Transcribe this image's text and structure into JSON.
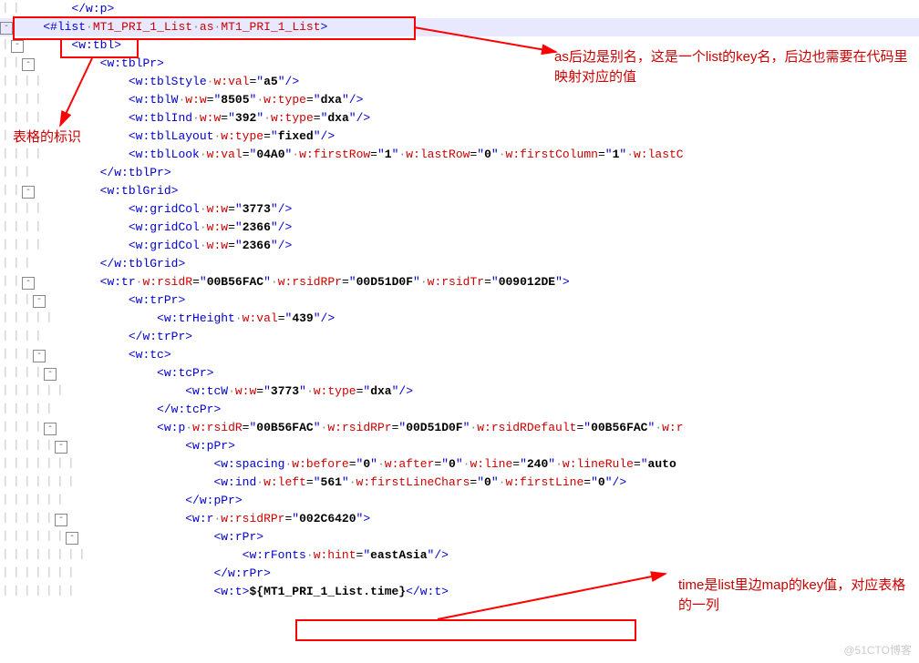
{
  "annotations": {
    "top_right": "as后边是别名，这是一个list的key名，后边也需要在代码里映射对应的值",
    "left": "表格的标识",
    "bottom_right": "time是list里边map的key值，对应表格的一列"
  },
  "watermark": "@51CTO博客",
  "lines": [
    {
      "indent": 2,
      "fold": false,
      "html": "<span class='sym'>&lt;/</span><span class='tag'>w:p</span><span class='sym'>&gt;</span>",
      "hl": false
    },
    {
      "indent": 1,
      "fold": true,
      "html": "<span class='sym'>&lt;</span><span class='tag'>#list</span><span class='dot'>·</span><span class='attr'>MT1_PRI_1_List</span><span class='dot'>·</span><span class='attr'>as</span><span class='dot'>·</span><span class='attr'>MT1_PRI_1_List</span><span class='sym'>&gt;</span>",
      "hl": true
    },
    {
      "indent": 2,
      "fold": true,
      "html": "<span class='sym'>&lt;</span><span class='tag'>w:tbl</span><span class='sym'>&gt;</span>",
      "hl": false
    },
    {
      "indent": 3,
      "fold": true,
      "html": "<span class='sym'>&lt;</span><span class='tag'>w:tblPr</span><span class='sym'>&gt;</span>",
      "hl": false
    },
    {
      "indent": 4,
      "fold": false,
      "html": "<span class='sym'>&lt;</span><span class='tag'>w:tblStyle</span><span class='dot'>·</span><span class='attr'>w:val</span>=<span class='sym'>\"</span><span class='val'>a5</span><span class='sym'>\"</span><span class='sym'>/&gt;</span>",
      "hl": false
    },
    {
      "indent": 4,
      "fold": false,
      "html": "<span class='sym'>&lt;</span><span class='tag'>w:tblW</span><span class='dot'>·</span><span class='attr'>w:w</span>=<span class='sym'>\"</span><span class='val'>8505</span><span class='sym'>\"</span><span class='dot'>·</span><span class='attr'>w:type</span>=<span class='sym'>\"</span><span class='val'>dxa</span><span class='sym'>\"</span><span class='sym'>/&gt;</span>",
      "hl": false
    },
    {
      "indent": 4,
      "fold": false,
      "html": "<span class='sym'>&lt;</span><span class='tag'>w:tblInd</span><span class='dot'>·</span><span class='attr'>w:w</span>=<span class='sym'>\"</span><span class='val'>392</span><span class='sym'>\"</span><span class='dot'>·</span><span class='attr'>w:type</span>=<span class='sym'>\"</span><span class='val'>dxa</span><span class='sym'>\"</span><span class='sym'>/&gt;</span>",
      "hl": false
    },
    {
      "indent": 4,
      "fold": false,
      "html": "<span class='sym'>&lt;</span><span class='tag'>w:tblLayout</span><span class='dot'>·</span><span class='attr'>w:type</span>=<span class='sym'>\"</span><span class='val'>fixed</span><span class='sym'>\"</span><span class='sym'>/&gt;</span>",
      "hl": false
    },
    {
      "indent": 4,
      "fold": false,
      "html": "<span class='sym'>&lt;</span><span class='tag'>w:tblLook</span><span class='dot'>·</span><span class='attr'>w:val</span>=<span class='sym'>\"</span><span class='val'>04A0</span><span class='sym'>\"</span><span class='dot'>·</span><span class='attr'>w:firstRow</span>=<span class='sym'>\"</span><span class='val'>1</span><span class='sym'>\"</span><span class='dot'>·</span><span class='attr'>w:lastRow</span>=<span class='sym'>\"</span><span class='val'>0</span><span class='sym'>\"</span><span class='dot'>·</span><span class='attr'>w:firstColumn</span>=<span class='sym'>\"</span><span class='val'>1</span><span class='sym'>\"</span><span class='dot'>·</span><span class='attr'>w:lastC</span>",
      "hl": false
    },
    {
      "indent": 3,
      "fold": false,
      "html": "<span class='sym'>&lt;/</span><span class='tag'>w:tblPr</span><span class='sym'>&gt;</span>",
      "hl": false
    },
    {
      "indent": 3,
      "fold": true,
      "html": "<span class='sym'>&lt;</span><span class='tag'>w:tblGrid</span><span class='sym'>&gt;</span>",
      "hl": false
    },
    {
      "indent": 4,
      "fold": false,
      "html": "<span class='sym'>&lt;</span><span class='tag'>w:gridCol</span><span class='dot'>·</span><span class='attr'>w:w</span>=<span class='sym'>\"</span><span class='val'>3773</span><span class='sym'>\"</span><span class='sym'>/&gt;</span>",
      "hl": false
    },
    {
      "indent": 4,
      "fold": false,
      "html": "<span class='sym'>&lt;</span><span class='tag'>w:gridCol</span><span class='dot'>·</span><span class='attr'>w:w</span>=<span class='sym'>\"</span><span class='val'>2366</span><span class='sym'>\"</span><span class='sym'>/&gt;</span>",
      "hl": false
    },
    {
      "indent": 4,
      "fold": false,
      "html": "<span class='sym'>&lt;</span><span class='tag'>w:gridCol</span><span class='dot'>·</span><span class='attr'>w:w</span>=<span class='sym'>\"</span><span class='val'>2366</span><span class='sym'>\"</span><span class='sym'>/&gt;</span>",
      "hl": false
    },
    {
      "indent": 3,
      "fold": false,
      "html": "<span class='sym'>&lt;/</span><span class='tag'>w:tblGrid</span><span class='sym'>&gt;</span>",
      "hl": false
    },
    {
      "indent": 3,
      "fold": true,
      "html": "<span class='sym'>&lt;</span><span class='tag'>w:tr</span><span class='dot'>·</span><span class='attr'>w:rsidR</span>=<span class='sym'>\"</span><span class='val'>00B56FAC</span><span class='sym'>\"</span><span class='dot'>·</span><span class='attr'>w:rsidRPr</span>=<span class='sym'>\"</span><span class='val'>00D51D0F</span><span class='sym'>\"</span><span class='dot'>·</span><span class='attr'>w:rsidTr</span>=<span class='sym'>\"</span><span class='val'>009012DE</span><span class='sym'>\"</span><span class='sym'>&gt;</span>",
      "hl": false
    },
    {
      "indent": 4,
      "fold": true,
      "html": "<span class='sym'>&lt;</span><span class='tag'>w:trPr</span><span class='sym'>&gt;</span>",
      "hl": false
    },
    {
      "indent": 5,
      "fold": false,
      "html": "<span class='sym'>&lt;</span><span class='tag'>w:trHeight</span><span class='dot'>·</span><span class='attr'>w:val</span>=<span class='sym'>\"</span><span class='val'>439</span><span class='sym'>\"</span><span class='sym'>/&gt;</span>",
      "hl": false
    },
    {
      "indent": 4,
      "fold": false,
      "html": "<span class='sym'>&lt;/</span><span class='tag'>w:trPr</span><span class='sym'>&gt;</span>",
      "hl": false
    },
    {
      "indent": 4,
      "fold": true,
      "html": "<span class='sym'>&lt;</span><span class='tag'>w:tc</span><span class='sym'>&gt;</span>",
      "hl": false
    },
    {
      "indent": 5,
      "fold": true,
      "html": "<span class='sym'>&lt;</span><span class='tag'>w:tcPr</span><span class='sym'>&gt;</span>",
      "hl": false
    },
    {
      "indent": 6,
      "fold": false,
      "html": "<span class='sym'>&lt;</span><span class='tag'>w:tcW</span><span class='dot'>·</span><span class='attr'>w:w</span>=<span class='sym'>\"</span><span class='val'>3773</span><span class='sym'>\"</span><span class='dot'>·</span><span class='attr'>w:type</span>=<span class='sym'>\"</span><span class='val'>dxa</span><span class='sym'>\"</span><span class='sym'>/&gt;</span>",
      "hl": false
    },
    {
      "indent": 5,
      "fold": false,
      "html": "<span class='sym'>&lt;/</span><span class='tag'>w:tcPr</span><span class='sym'>&gt;</span>",
      "hl": false
    },
    {
      "indent": 5,
      "fold": true,
      "html": "<span class='sym'>&lt;</span><span class='tag'>w:p</span><span class='dot'>·</span><span class='attr'>w:rsidR</span>=<span class='sym'>\"</span><span class='val'>00B56FAC</span><span class='sym'>\"</span><span class='dot'>·</span><span class='attr'>w:rsidRPr</span>=<span class='sym'>\"</span><span class='val'>00D51D0F</span><span class='sym'>\"</span><span class='dot'>·</span><span class='attr'>w:rsidRDefault</span>=<span class='sym'>\"</span><span class='val'>00B56FAC</span><span class='sym'>\"</span><span class='dot'>·</span><span class='attr'>w:r</span>",
      "hl": false
    },
    {
      "indent": 6,
      "fold": true,
      "html": "<span class='sym'>&lt;</span><span class='tag'>w:pPr</span><span class='sym'>&gt;</span>",
      "hl": false
    },
    {
      "indent": 7,
      "fold": false,
      "html": "<span class='sym'>&lt;</span><span class='tag'>w:spacing</span><span class='dot'>·</span><span class='attr'>w:before</span>=<span class='sym'>\"</span><span class='val'>0</span><span class='sym'>\"</span><span class='dot'>·</span><span class='attr'>w:after</span>=<span class='sym'>\"</span><span class='val'>0</span><span class='sym'>\"</span><span class='dot'>·</span><span class='attr'>w:line</span>=<span class='sym'>\"</span><span class='val'>240</span><span class='sym'>\"</span><span class='dot'>·</span><span class='attr'>w:lineRule</span>=<span class='sym'>\"</span><span class='val'>auto</span>",
      "hl": false
    },
    {
      "indent": 7,
      "fold": false,
      "html": "<span class='sym'>&lt;</span><span class='tag'>w:ind</span><span class='dot'>·</span><span class='attr'>w:left</span>=<span class='sym'>\"</span><span class='val'>561</span><span class='sym'>\"</span><span class='dot'>·</span><span class='attr'>w:firstLineChars</span>=<span class='sym'>\"</span><span class='val'>0</span><span class='sym'>\"</span><span class='dot'>·</span><span class='attr'>w:firstLine</span>=<span class='sym'>\"</span><span class='val'>0</span><span class='sym'>\"</span><span class='sym'>/&gt;</span>",
      "hl": false
    },
    {
      "indent": 6,
      "fold": false,
      "html": "<span class='sym'>&lt;/</span><span class='tag'>w:pPr</span><span class='sym'>&gt;</span>",
      "hl": false
    },
    {
      "indent": 6,
      "fold": true,
      "html": "<span class='sym'>&lt;</span><span class='tag'>w:r</span><span class='dot'>·</span><span class='attr'>w:rsidRPr</span>=<span class='sym'>\"</span><span class='val'>002C6420</span><span class='sym'>\"</span><span class='sym'>&gt;</span>",
      "hl": false
    },
    {
      "indent": 7,
      "fold": true,
      "html": "<span class='sym'>&lt;</span><span class='tag'>w:rPr</span><span class='sym'>&gt;</span>",
      "hl": false
    },
    {
      "indent": 8,
      "fold": false,
      "html": "<span class='sym'>&lt;</span><span class='tag'>w:rFonts</span><span class='dot'>·</span><span class='attr'>w:hint</span>=<span class='sym'>\"</span><span class='val'>eastAsia</span><span class='sym'>\"</span><span class='sym'>/&gt;</span>",
      "hl": false
    },
    {
      "indent": 7,
      "fold": false,
      "html": "<span class='sym'>&lt;/</span><span class='tag'>w:rPr</span><span class='sym'>&gt;</span>",
      "hl": false
    },
    {
      "indent": 7,
      "fold": false,
      "html": "<span class='sym'>&lt;</span><span class='tag'>w:t</span><span class='sym'>&gt;</span><span class='txt'>${MT1_PRI_1_List.time}</span><span class='sym'>&lt;/</span><span class='tag'>w:t</span><span class='sym'>&gt;</span>",
      "hl": false
    }
  ]
}
